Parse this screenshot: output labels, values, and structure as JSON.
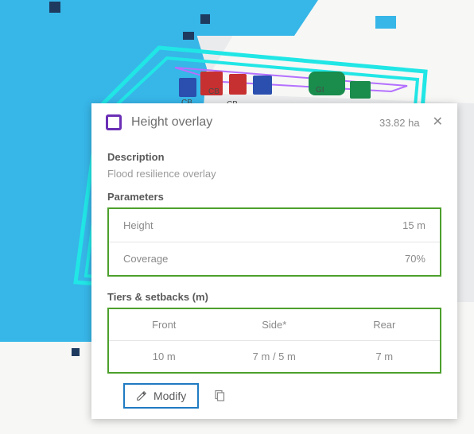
{
  "map": {
    "labels": [
      "CB",
      "CB",
      "CB",
      "GI"
    ]
  },
  "panel": {
    "title": "Height overlay",
    "area": "33.82 ha",
    "description_label": "Description",
    "description_text": "Flood resilience overlay",
    "parameters_label": "Parameters",
    "params": [
      {
        "name": "Height",
        "value": "15 m"
      },
      {
        "name": "Coverage",
        "value": "70%"
      }
    ],
    "tiers_label": "Tiers & setbacks (m)",
    "tiers": {
      "headers": [
        "Front",
        "Side*",
        "Rear"
      ],
      "values": [
        "10 m",
        "7 m / 5 m",
        "7 m"
      ]
    },
    "modify_label": "Modify"
  }
}
